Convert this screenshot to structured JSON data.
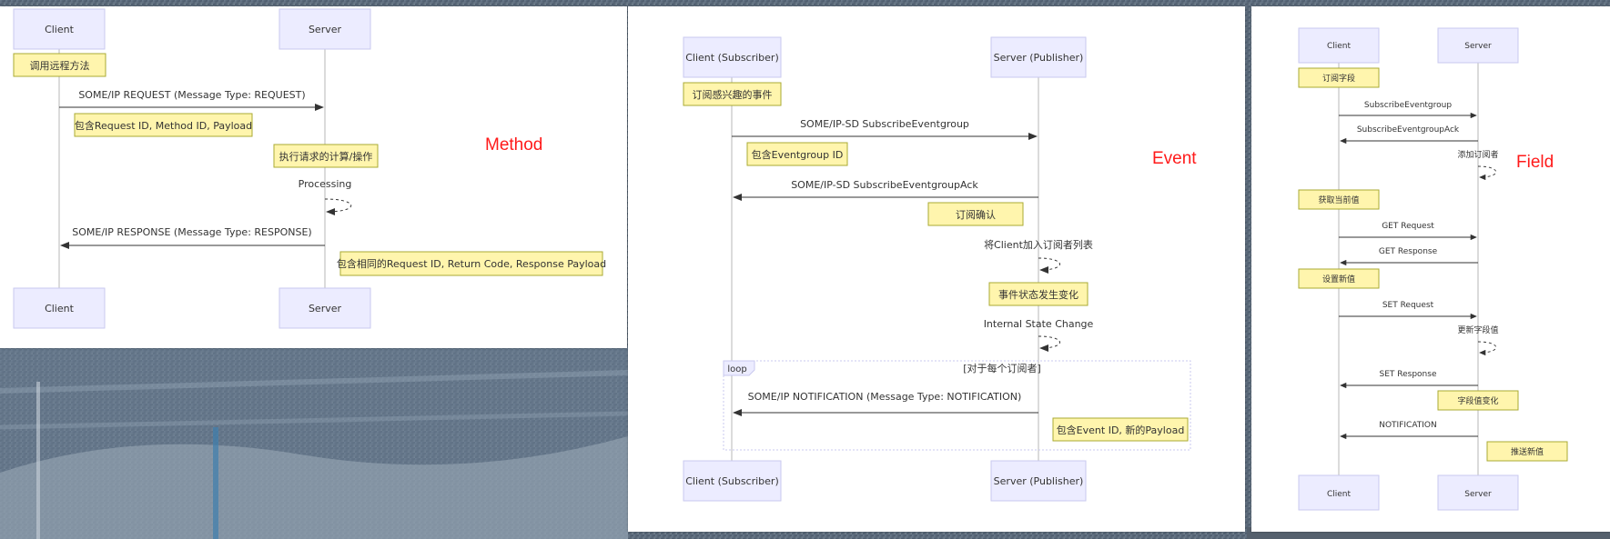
{
  "colors": {
    "actor_fill": "#ececff",
    "actor_stroke": "#c9c9ef",
    "note_fill": "#fff5ad",
    "note_stroke": "#aaaa33",
    "line": "#333333",
    "label_red": "#ff1a1a"
  },
  "diagrams": [
    {
      "label": "Method",
      "actors": [
        "Client",
        "Server"
      ],
      "messages": [
        {
          "id": "m1",
          "from": 0,
          "to": 1,
          "text": "SOME/IP REQUEST (Message Type: REQUEST)"
        },
        {
          "id": "m2",
          "self": 1,
          "text": "Processing"
        },
        {
          "id": "m3",
          "from": 1,
          "to": 0,
          "text": "SOME/IP RESPONSE (Message Type: RESPONSE)"
        }
      ],
      "notes": [
        {
          "id": "n1",
          "text": "调用远程方法"
        },
        {
          "id": "n2",
          "text": "包含Request ID, Method ID, Payload"
        },
        {
          "id": "n3",
          "text": "执行请求的计算/操作"
        },
        {
          "id": "n4",
          "text": "包含相同的Request ID, Return Code, Response Payload"
        }
      ]
    },
    {
      "label": "Event",
      "actors": [
        "Client (Subscriber)",
        "Server (Publisher)"
      ],
      "messages": [
        {
          "id": "m1",
          "from": 0,
          "to": 1,
          "text": "SOME/IP-SD SubscribeEventgroup"
        },
        {
          "id": "m2",
          "from": 1,
          "to": 0,
          "text": "SOME/IP-SD SubscribeEventgroupAck"
        },
        {
          "id": "m3",
          "self": 1,
          "text": "将Client加入订阅者列表"
        },
        {
          "id": "m4",
          "self": 1,
          "text": "Internal State Change"
        },
        {
          "id": "m5",
          "from": 1,
          "to": 0,
          "text": "SOME/IP NOTIFICATION (Message Type: NOTIFICATION)"
        }
      ],
      "notes": [
        {
          "id": "n1",
          "text": "订阅感兴趣的事件"
        },
        {
          "id": "n2",
          "text": "包含Eventgroup ID"
        },
        {
          "id": "n3",
          "text": "订阅确认"
        },
        {
          "id": "n4",
          "text": "事件状态发生变化"
        },
        {
          "id": "n5",
          "text": "包含Event ID, 新的Payload"
        }
      ],
      "loop": {
        "keyword": "loop",
        "condition": "[对于每个订阅者]"
      }
    },
    {
      "label": "Field",
      "actors": [
        "Client",
        "Server"
      ],
      "messages": [
        {
          "id": "m1",
          "from": 0,
          "to": 1,
          "text": "SubscribeEventgroup"
        },
        {
          "id": "m2",
          "from": 1,
          "to": 0,
          "text": "SubscribeEventgroupAck"
        },
        {
          "id": "m3",
          "self": 1,
          "text": "添加订阅者"
        },
        {
          "id": "m4",
          "from": 0,
          "to": 1,
          "text": "GET Request"
        },
        {
          "id": "m5",
          "from": 1,
          "to": 0,
          "text": "GET Response"
        },
        {
          "id": "m6",
          "from": 0,
          "to": 1,
          "text": "SET Request"
        },
        {
          "id": "m7",
          "self": 1,
          "text": "更新字段值"
        },
        {
          "id": "m8",
          "from": 1,
          "to": 0,
          "text": "SET Response"
        },
        {
          "id": "m9",
          "from": 1,
          "to": 0,
          "text": "NOTIFICATION"
        }
      ],
      "notes": [
        {
          "id": "n1",
          "text": "订阅字段"
        },
        {
          "id": "n2",
          "text": "获取当前值"
        },
        {
          "id": "n3",
          "text": "设置新值"
        },
        {
          "id": "n4",
          "text": "字段值变化"
        },
        {
          "id": "n5",
          "text": "推送新值"
        }
      ]
    }
  ]
}
